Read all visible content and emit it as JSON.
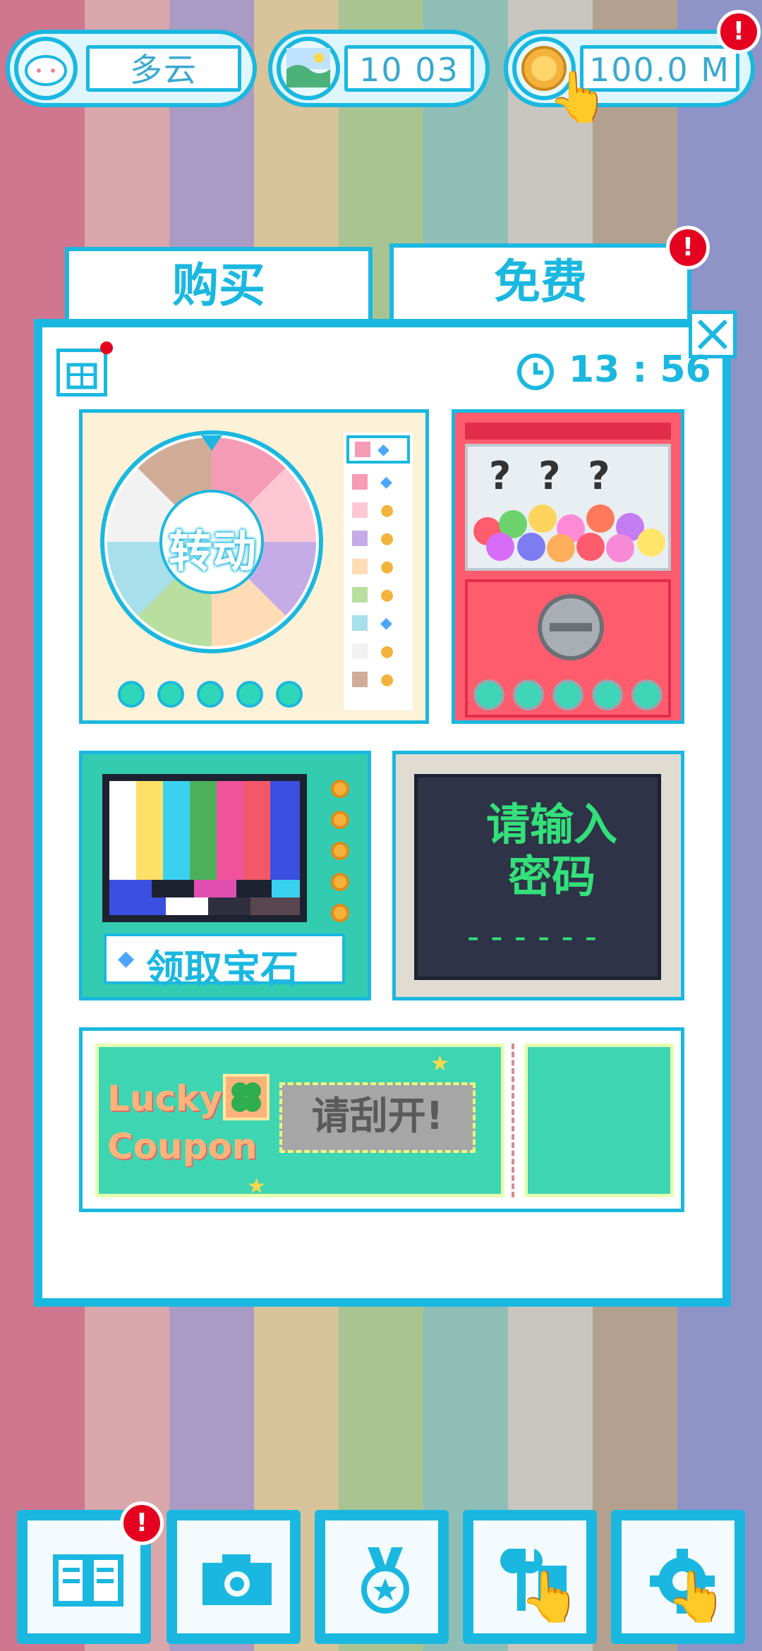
{
  "colors": {
    "stripes": [
      "#d0778f",
      "#d9a7ac",
      "#a99bc4",
      "#d8c39b",
      "#a8c492",
      "#8fbeb7",
      "#c9c6bf",
      "#b4a08f",
      "#8e93c8"
    ],
    "accent": "#1ab8e0",
    "badge": "#e6001f"
  },
  "topbar": {
    "weather_label": "多云",
    "weather_icon": "cloud-face-icon",
    "time_label": "10 03",
    "time_icon": "landscape-icon",
    "money_label": "100.0 M",
    "money_icon": "coin-icon",
    "money_badge": "!"
  },
  "tabs": {
    "buy": "购买",
    "free": "免费",
    "free_badge": "!"
  },
  "panel": {
    "timer": "13 : 56",
    "close_icon": "close-icon",
    "gift_icon": "gift-icon"
  },
  "wheel": {
    "label": "转动",
    "slice_colors": [
      "#f59bb6",
      "#ffc7d4",
      "#c6ace6",
      "#ffdcb6",
      "#b8dea0",
      "#a7dfeb",
      "#f2f2f2",
      "#d1ad99"
    ],
    "rewards": [
      "gem",
      "coin",
      "coin",
      "coin",
      "coin",
      "gem",
      "coin",
      "coin"
    ],
    "tokens": 5
  },
  "gacha": {
    "display": "? ? ?",
    "tokens": 5
  },
  "tv": {
    "label": "领取宝石"
  },
  "password": {
    "line1": "请输入",
    "line2": "密码",
    "blanks": "------"
  },
  "coupon": {
    "title1": "Lucky",
    "title2": "Coupon",
    "scratch": "请刮开!"
  },
  "bottom_nav": {
    "book_icon": "book-icon",
    "book_badge": "!",
    "camera_icon": "camera-icon",
    "medal_icon": "medal-icon",
    "tools_icon": "tools-icon",
    "settings_icon": "gear-icon"
  }
}
